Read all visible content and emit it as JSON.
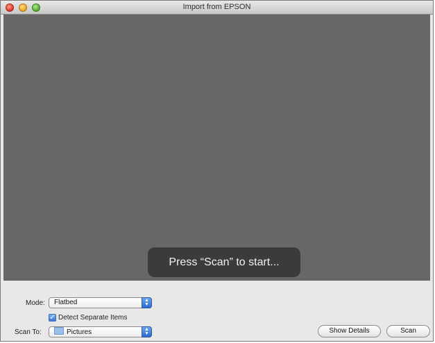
{
  "window": {
    "title": "Import from EPSON"
  },
  "preview": {
    "message": "Press “Scan” to start..."
  },
  "controls": {
    "mode": {
      "label": "Mode:",
      "value": "Flatbed"
    },
    "detect_separate": {
      "label": "Detect Separate Items",
      "checked": true
    },
    "scan_to": {
      "label": "Scan To:",
      "value": "Pictures"
    },
    "buttons": {
      "show_details": "Show Details",
      "scan": "Scan"
    }
  }
}
